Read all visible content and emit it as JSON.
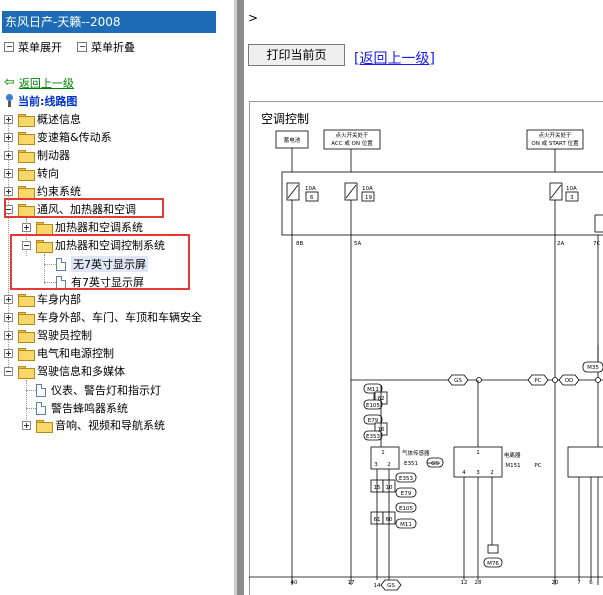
{
  "app": {
    "title": "东风日产-天籁--2008"
  },
  "toolbar": {
    "expand_label": "菜单展开",
    "collapse_label": "菜单折叠"
  },
  "nav": {
    "back_label": "返回上一级",
    "current_label": "当前:线路图"
  },
  "tree": {
    "items": [
      {
        "label": "概述信息"
      },
      {
        "label": "变速箱&传动系"
      },
      {
        "label": "制动器"
      },
      {
        "label": "转向"
      },
      {
        "label": "约束系统"
      },
      {
        "label": "通风、加热器和空调"
      },
      {
        "label": "加热器和空调系统"
      },
      {
        "label": "加热器和空调控制系统"
      },
      {
        "label": "无7英寸显示屏"
      },
      {
        "label": "有7英寸显示屏"
      },
      {
        "label": "车身内部"
      },
      {
        "label": "车身外部、车门、车顶和车辆安全"
      },
      {
        "label": "驾驶员控制"
      },
      {
        "label": "电气和电源控制"
      },
      {
        "label": "驾驶信息和多媒体"
      },
      {
        "label": "仪表、警告灯和指示灯"
      },
      {
        "label": "警告蜂鸣器系统"
      },
      {
        "label": "音响、视频和导航系统"
      }
    ]
  },
  "content": {
    "gt": ">",
    "print_label": "打印当前页",
    "back_up_label": "[返回上一级]",
    "diagram_title": "空调控制"
  },
  "diagram": {
    "box1": "蓄电池",
    "box2_l1": "点火开关处于",
    "box2_l2": "ACC 或 ON 位置",
    "box3_l1": "点火开关处于",
    "box3_l2": "ON 或 START 位置",
    "f1_amp": "10A",
    "f1_num": "6",
    "f2_amp": "10A",
    "f2_num": "19",
    "f3_amp": "10A",
    "f3_num": "3",
    "t_8b": "8B",
    "t_5a": "5A",
    "t_2a": "2A",
    "t_7c": "7C",
    "gs1": "GS",
    "pc": "PC",
    "od": "OD",
    "m35": "M35",
    "c_m11": "M11",
    "c_62": "62",
    "c_e105": "E105",
    "c_e79": "E79",
    "c_16": "16",
    "c_e353": "E353",
    "gas_sensor": "气体传感器",
    "e351": "E351",
    "gs2": "GS",
    "ionizer": "电离器",
    "m151": "M151",
    "pc2": "PC",
    "s_1a": "1",
    "s_3": "3",
    "s_2": "2",
    "s_1b": "1",
    "s_4": "4",
    "s_3b": "3",
    "s_2b": "2",
    "c2_e353": "E353",
    "c_15": "15",
    "c_10": "10",
    "c2_e79": "E79",
    "c2_e105": "E105",
    "c_61": "61",
    "c_60": "60",
    "c2_m11": "M11",
    "m76": "M76",
    "b_40": "40",
    "b_17": "17",
    "b_14": "14",
    "b_gs": "GS",
    "b_12": "12",
    "b_28": "28",
    "b_20": "20",
    "b_7": "7",
    "b_6": "6"
  }
}
